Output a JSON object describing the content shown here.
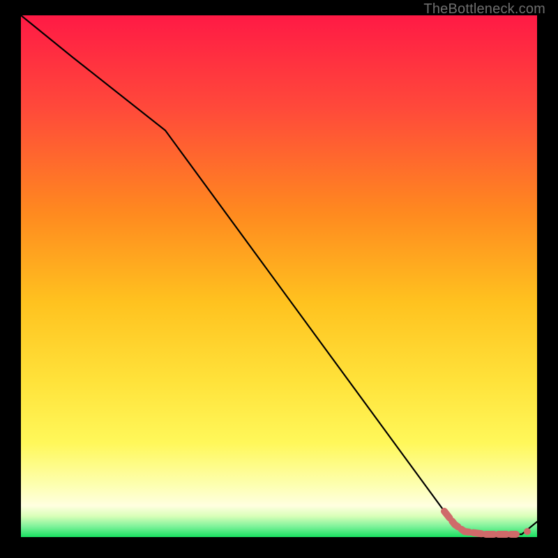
{
  "watermark": "TheBottleneck.com",
  "colors": {
    "background": "#000000",
    "gradient_top": "#ff1a45",
    "gradient_upper_mid": "#ff8a1f",
    "gradient_mid": "#ffd21f",
    "gradient_lower_mid": "#fff85a",
    "gradient_pale": "#ffffd4",
    "gradient_bottom": "#18e060",
    "curve": "#000000",
    "marker": "#cf6a6a"
  },
  "chart_data": {
    "type": "line",
    "title": "",
    "xlabel": "",
    "ylabel": "",
    "x_domain": [
      0,
      100
    ],
    "y_domain": [
      0,
      100
    ],
    "series": [
      {
        "name": "bottleneck-curve",
        "x": [
          0,
          10,
          28,
          82,
          86,
          90,
          94,
          97,
          100
        ],
        "y": [
          100,
          92,
          78,
          5,
          1,
          0.5,
          0.5,
          0.5,
          3
        ]
      }
    ],
    "markers": {
      "name": "highlight-segment",
      "x": [
        82,
        84,
        86,
        88,
        90,
        92,
        94,
        96
      ],
      "y": [
        5,
        2.5,
        1,
        0.8,
        0.5,
        0.5,
        0.5,
        0.5
      ]
    },
    "legend": [],
    "annotations": []
  }
}
